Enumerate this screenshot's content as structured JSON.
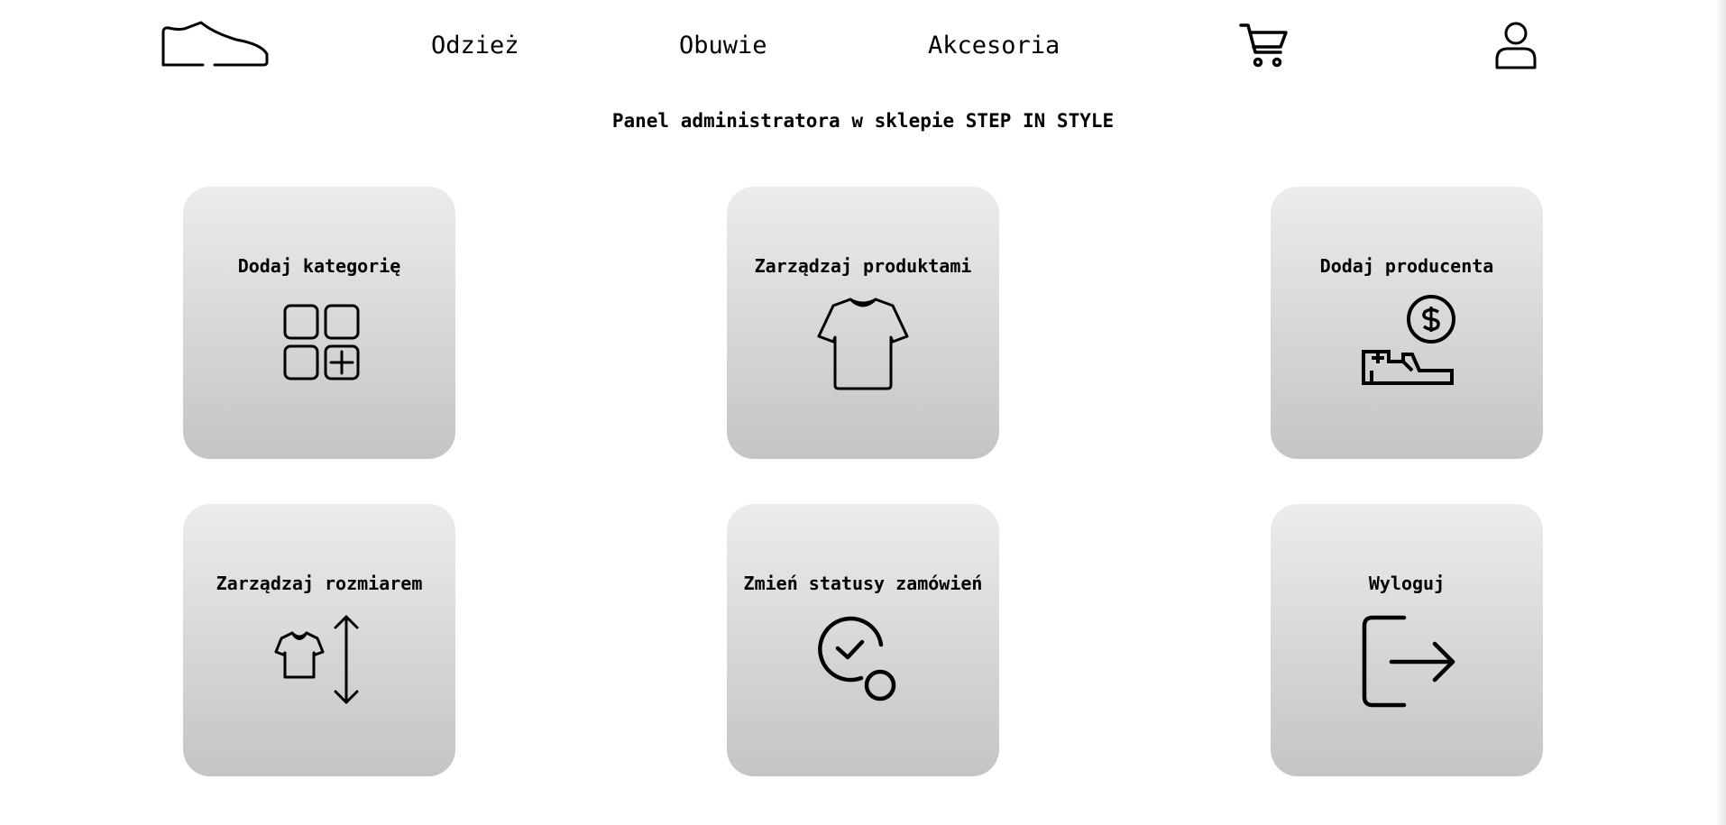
{
  "nav": {
    "logo_icon": "sneaker-icon",
    "links": [
      {
        "label": "Odzież"
      },
      {
        "label": "Obuwie"
      },
      {
        "label": "Akcesoria"
      }
    ],
    "cart_icon": "cart-icon",
    "user_icon": "user-icon"
  },
  "page": {
    "title": "Panel administratora w sklepie STEP IN STYLE"
  },
  "tiles": [
    {
      "label": "Dodaj kategorię",
      "icon": "grid-plus-icon"
    },
    {
      "label": "Zarządzaj produktami",
      "icon": "tshirt-icon"
    },
    {
      "label": "Dodaj producenta",
      "icon": "hand-money-icon"
    },
    {
      "label": "Zarządzaj rozmiarem",
      "icon": "tshirt-size-icon"
    },
    {
      "label": "Zmień statusy zamówień",
      "icon": "status-check-icon"
    },
    {
      "label": "Wyloguj",
      "icon": "logout-icon"
    }
  ],
  "colors": {
    "tile_gradient_top": "#ececec",
    "tile_gradient_bottom": "#c4c4c6",
    "text": "#000000",
    "background": "#ffffff"
  }
}
